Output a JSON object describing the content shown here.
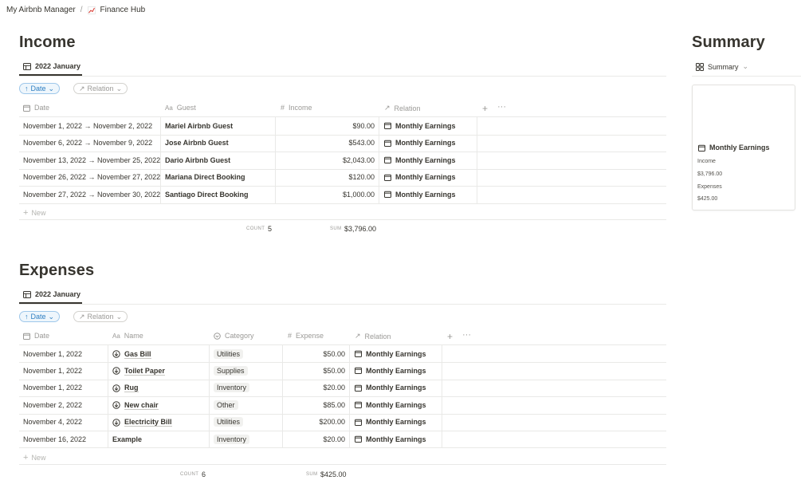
{
  "breadcrumb": {
    "workspace": "My Airbnb Manager",
    "page": "Finance Hub",
    "separator": "/"
  },
  "income": {
    "title": "Income",
    "view_tab": "2022 January",
    "filters": {
      "date": "Date",
      "relation": "Relation"
    },
    "columns": [
      "Date",
      "Guest",
      "Income",
      "Relation"
    ],
    "rows": [
      {
        "date": "November 1, 2022 → November 2, 2022",
        "guest": "Mariel Airbnb Guest",
        "income": "$90.00",
        "relation": "Monthly Earnings"
      },
      {
        "date": "November 6, 2022 → November 9, 2022",
        "guest": "Jose Airbnb Guest",
        "income": "$543.00",
        "relation": "Monthly Earnings"
      },
      {
        "date": "November 13, 2022 → November 25, 2022",
        "guest": "Dario Airbnb Guest",
        "income": "$2,043.00",
        "relation": "Monthly Earnings"
      },
      {
        "date": "November 26, 2022 → November 27, 2022",
        "guest": "Mariana Direct Booking",
        "income": "$120.00",
        "relation": "Monthly Earnings"
      },
      {
        "date": "November 27, 2022 → November 30, 2022",
        "guest": "Santiago Direct Booking",
        "income": "$1,000.00",
        "relation": "Monthly Earnings"
      }
    ],
    "new_label": "New",
    "count_label": "COUNT",
    "count_value": "5",
    "sum_label": "SUM",
    "sum_value": "$3,796.00"
  },
  "expenses": {
    "title": "Expenses",
    "view_tab": "2022 January",
    "filters": {
      "date": "Date",
      "relation": "Relation"
    },
    "columns": [
      "Date",
      "Name",
      "Category",
      "Expense",
      "Relation"
    ],
    "rows": [
      {
        "date": "November 1, 2022",
        "name": "Gas Bill",
        "category": "Utilities",
        "expense": "$50.00",
        "relation": "Monthly Earnings",
        "icon": true
      },
      {
        "date": "November 1, 2022",
        "name": "Toilet Paper",
        "category": "Supplies",
        "expense": "$50.00",
        "relation": "Monthly Earnings",
        "icon": true
      },
      {
        "date": "November 1, 2022",
        "name": "Rug",
        "category": "Inventory",
        "expense": "$20.00",
        "relation": "Monthly Earnings",
        "icon": true
      },
      {
        "date": "November 2, 2022",
        "name": "New chair",
        "category": "Other",
        "expense": "$85.00",
        "relation": "Monthly Earnings",
        "icon": true
      },
      {
        "date": "November 4, 2022",
        "name": "Electricity Bill",
        "category": "Utilities",
        "expense": "$200.00",
        "relation": "Monthly Earnings",
        "icon": true
      },
      {
        "date": "November 16, 2022",
        "name": "Example",
        "category": "Inventory",
        "expense": "$20.00",
        "relation": "Monthly Earnings",
        "icon": false
      }
    ],
    "new_label": "New",
    "count_label": "COUNT",
    "count_value": "6",
    "sum_label": "SUM",
    "sum_value": "$425.00"
  },
  "summary": {
    "title": "Summary",
    "view_tab": "Summary",
    "card": {
      "title": "Monthly Earnings",
      "income_label": "Income",
      "income_value": "$3,796.00",
      "expenses_label": "Expenses",
      "expenses_value": "$425.00"
    }
  },
  "colors": {
    "text": "#37352f",
    "muted": "#9b9a97",
    "border": "#e9e9e7",
    "accent": "#2f7fc1"
  }
}
